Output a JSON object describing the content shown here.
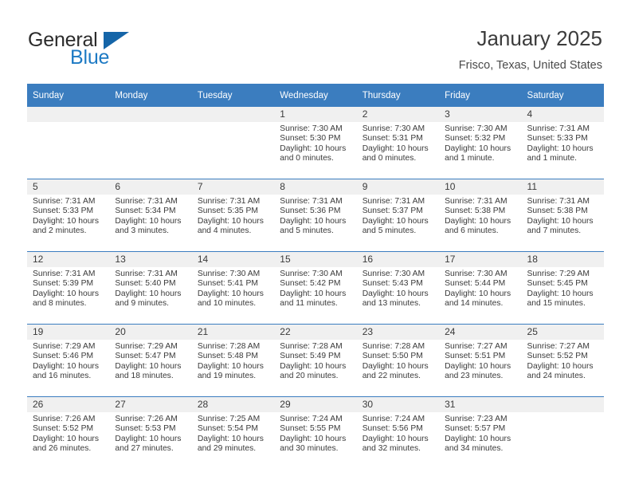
{
  "brand": {
    "name_top": "General",
    "name_bottom": "Blue",
    "accent_color": "#1d7ac4",
    "triangle_color": "#1565a8"
  },
  "header": {
    "title": "January 2025",
    "subtitle": "Frisco, Texas, United States"
  },
  "calendar": {
    "header_bg": "#3b7dbf",
    "daynum_bg": "#f0f0f0",
    "weekday_headers": [
      "Sunday",
      "Monday",
      "Tuesday",
      "Wednesday",
      "Thursday",
      "Friday",
      "Saturday"
    ],
    "weeks": [
      [
        {
          "day": "",
          "sunrise": "",
          "sunset": "",
          "daylight_a": "",
          "daylight_b": "",
          "empty": true
        },
        {
          "day": "",
          "sunrise": "",
          "sunset": "",
          "daylight_a": "",
          "daylight_b": "",
          "empty": true
        },
        {
          "day": "",
          "sunrise": "",
          "sunset": "",
          "daylight_a": "",
          "daylight_b": "",
          "empty": true
        },
        {
          "day": "1",
          "sunrise": "Sunrise: 7:30 AM",
          "sunset": "Sunset: 5:30 PM",
          "daylight_a": "Daylight: 10 hours",
          "daylight_b": "and 0 minutes."
        },
        {
          "day": "2",
          "sunrise": "Sunrise: 7:30 AM",
          "sunset": "Sunset: 5:31 PM",
          "daylight_a": "Daylight: 10 hours",
          "daylight_b": "and 0 minutes."
        },
        {
          "day": "3",
          "sunrise": "Sunrise: 7:30 AM",
          "sunset": "Sunset: 5:32 PM",
          "daylight_a": "Daylight: 10 hours",
          "daylight_b": "and 1 minute."
        },
        {
          "day": "4",
          "sunrise": "Sunrise: 7:31 AM",
          "sunset": "Sunset: 5:33 PM",
          "daylight_a": "Daylight: 10 hours",
          "daylight_b": "and 1 minute."
        }
      ],
      [
        {
          "day": "5",
          "sunrise": "Sunrise: 7:31 AM",
          "sunset": "Sunset: 5:33 PM",
          "daylight_a": "Daylight: 10 hours",
          "daylight_b": "and 2 minutes."
        },
        {
          "day": "6",
          "sunrise": "Sunrise: 7:31 AM",
          "sunset": "Sunset: 5:34 PM",
          "daylight_a": "Daylight: 10 hours",
          "daylight_b": "and 3 minutes."
        },
        {
          "day": "7",
          "sunrise": "Sunrise: 7:31 AM",
          "sunset": "Sunset: 5:35 PM",
          "daylight_a": "Daylight: 10 hours",
          "daylight_b": "and 4 minutes."
        },
        {
          "day": "8",
          "sunrise": "Sunrise: 7:31 AM",
          "sunset": "Sunset: 5:36 PM",
          "daylight_a": "Daylight: 10 hours",
          "daylight_b": "and 5 minutes."
        },
        {
          "day": "9",
          "sunrise": "Sunrise: 7:31 AM",
          "sunset": "Sunset: 5:37 PM",
          "daylight_a": "Daylight: 10 hours",
          "daylight_b": "and 5 minutes."
        },
        {
          "day": "10",
          "sunrise": "Sunrise: 7:31 AM",
          "sunset": "Sunset: 5:38 PM",
          "daylight_a": "Daylight: 10 hours",
          "daylight_b": "and 6 minutes."
        },
        {
          "day": "11",
          "sunrise": "Sunrise: 7:31 AM",
          "sunset": "Sunset: 5:38 PM",
          "daylight_a": "Daylight: 10 hours",
          "daylight_b": "and 7 minutes."
        }
      ],
      [
        {
          "day": "12",
          "sunrise": "Sunrise: 7:31 AM",
          "sunset": "Sunset: 5:39 PM",
          "daylight_a": "Daylight: 10 hours",
          "daylight_b": "and 8 minutes."
        },
        {
          "day": "13",
          "sunrise": "Sunrise: 7:31 AM",
          "sunset": "Sunset: 5:40 PM",
          "daylight_a": "Daylight: 10 hours",
          "daylight_b": "and 9 minutes."
        },
        {
          "day": "14",
          "sunrise": "Sunrise: 7:30 AM",
          "sunset": "Sunset: 5:41 PM",
          "daylight_a": "Daylight: 10 hours",
          "daylight_b": "and 10 minutes."
        },
        {
          "day": "15",
          "sunrise": "Sunrise: 7:30 AM",
          "sunset": "Sunset: 5:42 PM",
          "daylight_a": "Daylight: 10 hours",
          "daylight_b": "and 11 minutes."
        },
        {
          "day": "16",
          "sunrise": "Sunrise: 7:30 AM",
          "sunset": "Sunset: 5:43 PM",
          "daylight_a": "Daylight: 10 hours",
          "daylight_b": "and 13 minutes."
        },
        {
          "day": "17",
          "sunrise": "Sunrise: 7:30 AM",
          "sunset": "Sunset: 5:44 PM",
          "daylight_a": "Daylight: 10 hours",
          "daylight_b": "and 14 minutes."
        },
        {
          "day": "18",
          "sunrise": "Sunrise: 7:29 AM",
          "sunset": "Sunset: 5:45 PM",
          "daylight_a": "Daylight: 10 hours",
          "daylight_b": "and 15 minutes."
        }
      ],
      [
        {
          "day": "19",
          "sunrise": "Sunrise: 7:29 AM",
          "sunset": "Sunset: 5:46 PM",
          "daylight_a": "Daylight: 10 hours",
          "daylight_b": "and 16 minutes."
        },
        {
          "day": "20",
          "sunrise": "Sunrise: 7:29 AM",
          "sunset": "Sunset: 5:47 PM",
          "daylight_a": "Daylight: 10 hours",
          "daylight_b": "and 18 minutes."
        },
        {
          "day": "21",
          "sunrise": "Sunrise: 7:28 AM",
          "sunset": "Sunset: 5:48 PM",
          "daylight_a": "Daylight: 10 hours",
          "daylight_b": "and 19 minutes."
        },
        {
          "day": "22",
          "sunrise": "Sunrise: 7:28 AM",
          "sunset": "Sunset: 5:49 PM",
          "daylight_a": "Daylight: 10 hours",
          "daylight_b": "and 20 minutes."
        },
        {
          "day": "23",
          "sunrise": "Sunrise: 7:28 AM",
          "sunset": "Sunset: 5:50 PM",
          "daylight_a": "Daylight: 10 hours",
          "daylight_b": "and 22 minutes."
        },
        {
          "day": "24",
          "sunrise": "Sunrise: 7:27 AM",
          "sunset": "Sunset: 5:51 PM",
          "daylight_a": "Daylight: 10 hours",
          "daylight_b": "and 23 minutes."
        },
        {
          "day": "25",
          "sunrise": "Sunrise: 7:27 AM",
          "sunset": "Sunset: 5:52 PM",
          "daylight_a": "Daylight: 10 hours",
          "daylight_b": "and 24 minutes."
        }
      ],
      [
        {
          "day": "26",
          "sunrise": "Sunrise: 7:26 AM",
          "sunset": "Sunset: 5:52 PM",
          "daylight_a": "Daylight: 10 hours",
          "daylight_b": "and 26 minutes."
        },
        {
          "day": "27",
          "sunrise": "Sunrise: 7:26 AM",
          "sunset": "Sunset: 5:53 PM",
          "daylight_a": "Daylight: 10 hours",
          "daylight_b": "and 27 minutes."
        },
        {
          "day": "28",
          "sunrise": "Sunrise: 7:25 AM",
          "sunset": "Sunset: 5:54 PM",
          "daylight_a": "Daylight: 10 hours",
          "daylight_b": "and 29 minutes."
        },
        {
          "day": "29",
          "sunrise": "Sunrise: 7:24 AM",
          "sunset": "Sunset: 5:55 PM",
          "daylight_a": "Daylight: 10 hours",
          "daylight_b": "and 30 minutes."
        },
        {
          "day": "30",
          "sunrise": "Sunrise: 7:24 AM",
          "sunset": "Sunset: 5:56 PM",
          "daylight_a": "Daylight: 10 hours",
          "daylight_b": "and 32 minutes."
        },
        {
          "day": "31",
          "sunrise": "Sunrise: 7:23 AM",
          "sunset": "Sunset: 5:57 PM",
          "daylight_a": "Daylight: 10 hours",
          "daylight_b": "and 34 minutes."
        },
        {
          "day": "",
          "sunrise": "",
          "sunset": "",
          "daylight_a": "",
          "daylight_b": "",
          "empty": true
        }
      ]
    ]
  }
}
